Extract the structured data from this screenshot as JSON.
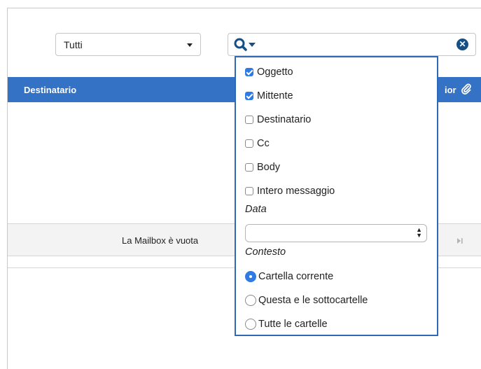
{
  "filter": {
    "selected": "Tutti"
  },
  "search": {
    "value": ""
  },
  "table": {
    "header_destinatario": "Destinatario",
    "header_right_fragment": "ior",
    "empty_message": "La Mailbox è vuota"
  },
  "search_options": {
    "fields": [
      {
        "label": "Oggetto",
        "checked": true
      },
      {
        "label": "Mittente",
        "checked": true
      },
      {
        "label": "Destinatario",
        "checked": false
      },
      {
        "label": "Cc",
        "checked": false
      },
      {
        "label": "Body",
        "checked": false
      },
      {
        "label": "Intero messaggio",
        "checked": false
      }
    ],
    "date_label": "Data",
    "date_value": "",
    "context_label": "Contesto",
    "contexts": [
      {
        "label": "Cartella corrente",
        "selected": true
      },
      {
        "label": "Questa e le sottocartelle",
        "selected": false
      },
      {
        "label": "Tutte le cartelle",
        "selected": false
      }
    ]
  },
  "colors": {
    "header_blue": "#3472c5",
    "accent": "#2f7ae5",
    "dropdown_border": "#2f68b6",
    "search_icon": "#174f84"
  }
}
